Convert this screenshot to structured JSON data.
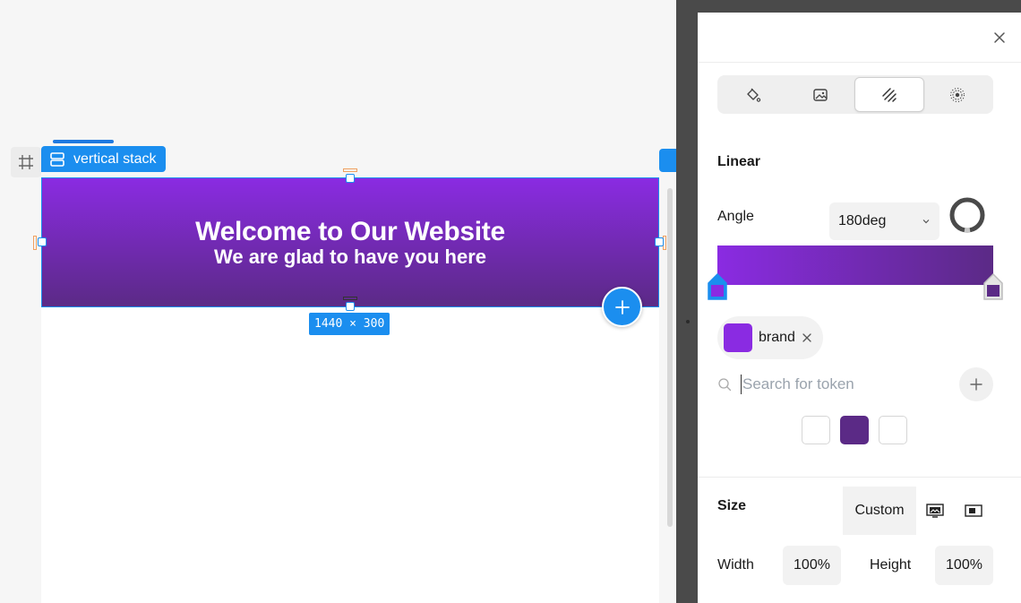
{
  "canvas": {
    "badge_label": "vertical stack",
    "hero_title": "Welcome to Our Website",
    "hero_subtitle": "We are glad to have you here",
    "dimensions_label": "1440 × 300"
  },
  "panel": {
    "fill_tabs": [
      "paint-bucket-icon",
      "image-icon",
      "gradient-icon",
      "radial-icon"
    ],
    "active_tab": "gradient-icon",
    "gradient_type": "Linear",
    "angle_label": "Angle",
    "angle_value": "180deg",
    "gradient_start_color": "#8a2be2",
    "gradient_end_color": "#5b2a86",
    "token_name": "brand",
    "token_color": "#8a2be2",
    "search_placeholder": "Search for token",
    "swatch_colors": [
      "#ffffff",
      "#5b2a86",
      "#ffffff"
    ],
    "size_label": "Size",
    "size_mode": "Custom",
    "width_label": "Width",
    "width_value": "100%",
    "height_label": "Height",
    "height_value": "100%"
  },
  "colors": {
    "accent": "#1b8eef",
    "brand": "#8a2be2"
  }
}
